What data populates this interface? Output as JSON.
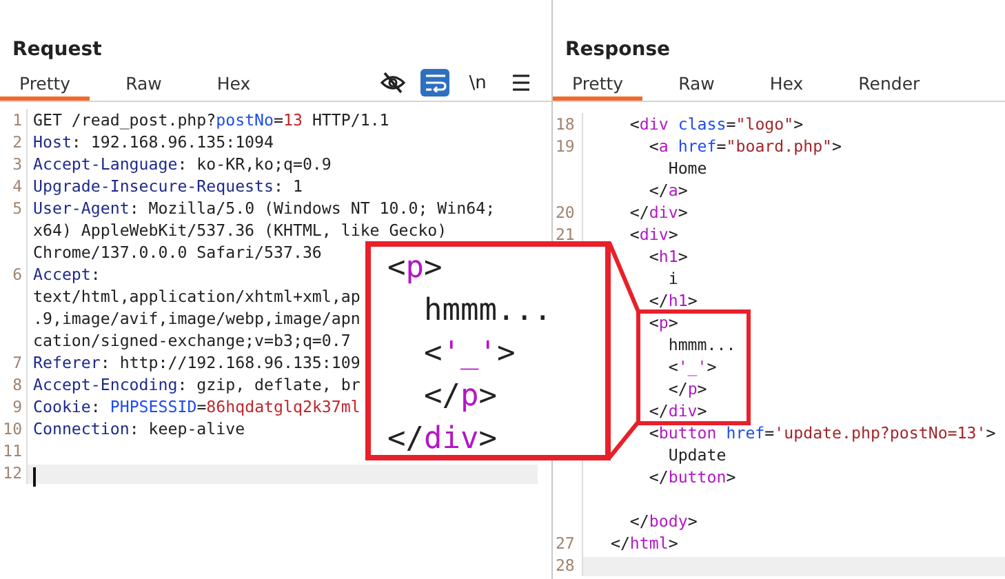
{
  "request": {
    "title": "Request",
    "tabs": [
      {
        "label": "Pretty",
        "selected": true
      },
      {
        "label": "Raw",
        "selected": false
      },
      {
        "label": "Hex",
        "selected": false
      }
    ],
    "toolbar": [
      {
        "kind": "hide",
        "on": false
      },
      {
        "kind": "wrap",
        "on": true
      },
      {
        "kind": "text",
        "label": "\\n",
        "on": false
      },
      {
        "kind": "menu",
        "on": false
      }
    ],
    "lines": [
      {
        "number": "1",
        "current": false,
        "segments": [
          {
            "text": "GET /read_post.php?",
            "kind": "plain"
          },
          {
            "text": "postNo",
            "kind": "param"
          },
          {
            "text": "=",
            "kind": "plain"
          },
          {
            "text": "13",
            "kind": "value"
          },
          {
            "text": " HTTP/1.1",
            "kind": "plain"
          }
        ]
      },
      {
        "number": "2",
        "current": false,
        "segments": [
          {
            "text": "Host",
            "kind": "header"
          },
          {
            "text": ": 192.168.96.135:1094",
            "kind": "plain"
          }
        ]
      },
      {
        "number": "3",
        "current": false,
        "segments": [
          {
            "text": "Accept-Language",
            "kind": "header"
          },
          {
            "text": ": ko-KR,ko;q=0.9",
            "kind": "plain"
          }
        ]
      },
      {
        "number": "4",
        "current": false,
        "segments": [
          {
            "text": "Upgrade-Insecure-Requests",
            "kind": "header"
          },
          {
            "text": ": 1",
            "kind": "plain"
          }
        ]
      },
      {
        "number": "5",
        "current": false,
        "segments": [
          {
            "text": "User-Agent",
            "kind": "header"
          },
          {
            "text": ": Mozilla/5.0 (Windows NT 10.0; Win64;",
            "kind": "plain"
          }
        ]
      },
      {
        "current": false,
        "segments": [
          {
            "text": "x64) AppleWebKit/537.36 (KHTML, like Gecko)",
            "kind": "plain"
          }
        ]
      },
      {
        "current": false,
        "segments": [
          {
            "text": "Chrome/137.0.0.0 Safari/537.36",
            "kind": "plain"
          }
        ]
      },
      {
        "number": "6",
        "current": false,
        "segments": [
          {
            "text": "Accept",
            "kind": "header"
          },
          {
            "text": ":",
            "kind": "plain"
          }
        ]
      },
      {
        "current": false,
        "segments": [
          {
            "text": "text/html,application/xhtml+xml,ap",
            "kind": "plain"
          }
        ]
      },
      {
        "current": false,
        "segments": [
          {
            "text": ".9,image/avif,image/webp,image/apn",
            "kind": "plain"
          }
        ]
      },
      {
        "current": false,
        "segments": [
          {
            "text": "cation/signed-exchange;v=b3;q=0.7",
            "kind": "plain"
          }
        ]
      },
      {
        "number": "7",
        "current": false,
        "segments": [
          {
            "text": "Referer",
            "kind": "header"
          },
          {
            "text": ": http://192.168.96.135:109",
            "kind": "plain"
          }
        ]
      },
      {
        "number": "8",
        "current": false,
        "segments": [
          {
            "text": "Accept-Encoding",
            "kind": "header"
          },
          {
            "text": ": gzip, deflate, br",
            "kind": "plain"
          }
        ]
      },
      {
        "number": "9",
        "current": false,
        "segments": [
          {
            "text": "Cookie",
            "kind": "header"
          },
          {
            "text": ": ",
            "kind": "plain"
          },
          {
            "text": "PHPSESSID",
            "kind": "param"
          },
          {
            "text": "=",
            "kind": "plain"
          },
          {
            "text": "86hqdatglq2k37ml",
            "kind": "value"
          }
        ]
      },
      {
        "number": "10",
        "current": false,
        "segments": [
          {
            "text": "Connection",
            "kind": "header"
          },
          {
            "text": ": keep-alive",
            "kind": "plain"
          }
        ]
      },
      {
        "number": "11",
        "current": false
      },
      {
        "number": "12",
        "current": true
      }
    ]
  },
  "response": {
    "title": "Response",
    "tabs": [
      {
        "label": "Pretty",
        "selected": true
      },
      {
        "label": "Raw",
        "selected": false
      },
      {
        "label": "Hex",
        "selected": false
      },
      {
        "label": "Render",
        "selected": false
      }
    ],
    "lines": [
      {
        "number": "18",
        "current": false,
        "segments": [
          {
            "text": "    <",
            "kind": "plain"
          },
          {
            "text": "div",
            "kind": "tag"
          },
          {
            "text": " class",
            "kind": "attr"
          },
          {
            "text": "=",
            "kind": "plain"
          },
          {
            "text": "\"logo\"",
            "kind": "string"
          },
          {
            "text": ">",
            "kind": "plain"
          }
        ]
      },
      {
        "number": "19",
        "current": false,
        "segments": [
          {
            "text": "      <",
            "kind": "plain"
          },
          {
            "text": "a",
            "kind": "tag"
          },
          {
            "text": " href",
            "kind": "attr"
          },
          {
            "text": "=",
            "kind": "plain"
          },
          {
            "text": "\"board.php\"",
            "kind": "string"
          },
          {
            "text": ">",
            "kind": "plain"
          }
        ]
      },
      {
        "current": false,
        "segments": [
          {
            "text": "        Home",
            "kind": "plain"
          }
        ]
      },
      {
        "current": false,
        "segments": [
          {
            "text": "      </",
            "kind": "plain"
          },
          {
            "text": "a",
            "kind": "tag"
          },
          {
            "text": ">",
            "kind": "plain"
          }
        ]
      },
      {
        "number": "20",
        "current": false,
        "segments": [
          {
            "text": "    </",
            "kind": "plain"
          },
          {
            "text": "div",
            "kind": "tag"
          },
          {
            "text": ">",
            "kind": "plain"
          }
        ]
      },
      {
        "number": "21",
        "current": false,
        "segments": [
          {
            "text": "    <",
            "kind": "plain"
          },
          {
            "text": "div",
            "kind": "tag"
          },
          {
            "text": ">",
            "kind": "plain"
          }
        ]
      },
      {
        "current": false,
        "segments": [
          {
            "text": "      <",
            "kind": "plain"
          },
          {
            "text": "h1",
            "kind": "tag"
          },
          {
            "text": ">",
            "kind": "plain"
          }
        ]
      },
      {
        "current": false,
        "segments": [
          {
            "text": "        i",
            "kind": "plain"
          }
        ]
      },
      {
        "current": false,
        "segments": [
          {
            "text": "      </",
            "kind": "plain"
          },
          {
            "text": "h1",
            "kind": "tag"
          },
          {
            "text": ">",
            "kind": "plain"
          }
        ]
      },
      {
        "current": false,
        "segments": [
          {
            "text": "      <",
            "kind": "plain"
          },
          {
            "text": "p",
            "kind": "tag"
          },
          {
            "text": ">",
            "kind": "plain"
          }
        ]
      },
      {
        "current": false,
        "segments": [
          {
            "text": "        hmmm...",
            "kind": "plain"
          }
        ]
      },
      {
        "current": false,
        "segments": [
          {
            "text": "        <",
            "kind": "plain"
          },
          {
            "text": "'_'",
            "kind": "tag"
          },
          {
            "text": ">",
            "kind": "plain"
          }
        ]
      },
      {
        "current": false,
        "segments": [
          {
            "text": "        </",
            "kind": "plain"
          },
          {
            "text": "p",
            "kind": "tag"
          },
          {
            "text": ">",
            "kind": "plain"
          }
        ]
      },
      {
        "current": false,
        "segments": [
          {
            "text": "      </",
            "kind": "plain"
          },
          {
            "text": "div",
            "kind": "tag"
          },
          {
            "text": ">",
            "kind": "plain"
          }
        ]
      },
      {
        "current": false,
        "segments": [
          {
            "text": "      <",
            "kind": "plain"
          },
          {
            "text": "button",
            "kind": "tag"
          },
          {
            "text": " href",
            "kind": "attr"
          },
          {
            "text": "=",
            "kind": "plain"
          },
          {
            "text": "'update.php?postNo=13'",
            "kind": "string"
          },
          {
            "text": ">",
            "kind": "plain"
          }
        ]
      },
      {
        "current": false,
        "segments": [
          {
            "text": "        Update",
            "kind": "plain"
          }
        ]
      },
      {
        "current": false,
        "segments": [
          {
            "text": "      </",
            "kind": "plain"
          },
          {
            "text": "button",
            "kind": "tag"
          },
          {
            "text": ">",
            "kind": "plain"
          }
        ]
      },
      {
        "current": false
      },
      {
        "current": false,
        "segments": [
          {
            "text": "    </",
            "kind": "plain"
          },
          {
            "text": "body",
            "kind": "tag"
          },
          {
            "text": ">",
            "kind": "plain"
          }
        ]
      },
      {
        "number": "27",
        "current": false,
        "segments": [
          {
            "text": "  </",
            "kind": "plain"
          },
          {
            "text": "html",
            "kind": "tag"
          },
          {
            "text": ">",
            "kind": "plain"
          }
        ]
      },
      {
        "number": "28",
        "current": true
      }
    ]
  },
  "callout": {
    "lines": [
      {
        "segments": [
          {
            "text": "<",
            "kind": "plain"
          },
          {
            "text": "p",
            "kind": "tag"
          },
          {
            "text": ">",
            "kind": "plain"
          }
        ]
      },
      {
        "segments": [
          {
            "text": "  hmmm...",
            "kind": "plain"
          }
        ]
      },
      {
        "segments": [
          {
            "text": "  <",
            "kind": "plain"
          },
          {
            "text": "'_'",
            "kind": "tag"
          },
          {
            "text": ">",
            "kind": "plain"
          }
        ]
      },
      {
        "segments": [
          {
            "text": "  </",
            "kind": "plain"
          },
          {
            "text": "p",
            "kind": "tag"
          },
          {
            "text": ">",
            "kind": "plain"
          }
        ]
      },
      {
        "segments": [
          {
            "text": "</",
            "kind": "plain"
          },
          {
            "text": "div",
            "kind": "tag"
          },
          {
            "text": ">",
            "kind": "plain"
          }
        ]
      }
    ]
  }
}
